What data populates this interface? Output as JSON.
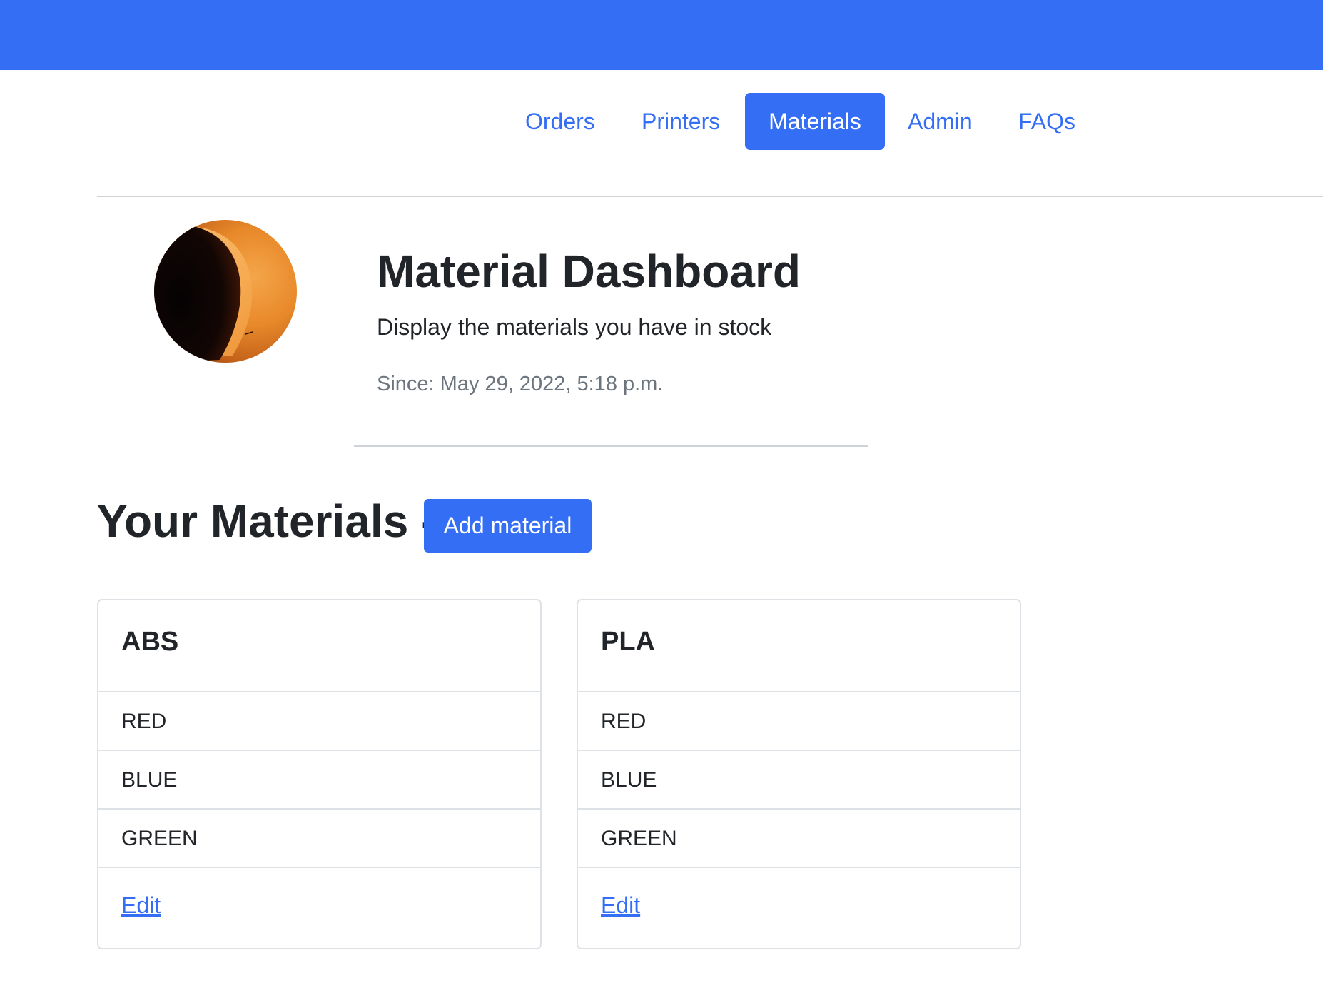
{
  "colors": {
    "brand_blue": "#346ef4",
    "text_dark": "#212529",
    "text_muted": "#6c757d",
    "border": "#dee2e6"
  },
  "nav": {
    "items": [
      {
        "label": "Orders",
        "active": false
      },
      {
        "label": "Printers",
        "active": false
      },
      {
        "label": "Materials",
        "active": true
      },
      {
        "label": "Admin",
        "active": false
      },
      {
        "label": "FAQs",
        "active": false
      }
    ]
  },
  "header": {
    "avatar_icon": "profile-avatar-image",
    "title": "Material Dashboard",
    "subtitle": "Display the materials you have in stock",
    "since": "Since: May 29, 2022, 5:18 p.m."
  },
  "materials_section": {
    "title": "Your Materials -",
    "add_button_label": "Add material"
  },
  "materials": [
    {
      "name": "ABS",
      "colors": [
        "RED",
        "BLUE",
        "GREEN"
      ],
      "edit_label": "Edit"
    },
    {
      "name": "PLA",
      "colors": [
        "RED",
        "BLUE",
        "GREEN"
      ],
      "edit_label": "Edit"
    }
  ]
}
